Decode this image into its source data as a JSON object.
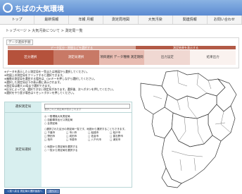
{
  "app": {
    "title": "ちばの大気環境"
  },
  "nav": [
    "トップ",
    "最新情報",
    "年報 月報",
    "測定局地図",
    "大気汚染",
    "関連情報",
    "お問い合わせ"
  ],
  "breadcrumb": "トップページ > 大気汚染について > 測定局一覧",
  "panel": {
    "title": "データ選択手順"
  },
  "progress": {
    "left_text": "データ区分・期間などを選択する",
    "right_text": "測定結果を表示する"
  },
  "steps": [
    "区分選択",
    "測定局選択",
    "項目選択 データ種類 測定期間",
    "出力設定",
    "結果出力"
  ],
  "instructions": [
    "※データを表示したい測定局を一覧または地図から選択してください。",
    "※地図上の測定局をクリックすると選択できます。",
    "※複数の測定局を選択する場合は、Ctrlキーを押しながら選択してください。",
    "※選択した測定局は下の表示欄に表示されます。",
    "※測定局は最大10局まで選択できます。",
    "※区分によっては、選択できない測定局があります。選択後、次へボタンを押してください。",
    "※選択をやり直す場合はリセットボタンを押してください。"
  ],
  "form": {
    "label1": "選択測定局",
    "hint": "選択された測定局が表示されます",
    "label2": "測定局選択",
    "options_top": [
      "◎ 一般環境大気測定局",
      "○ 自動車排出ガス測定局",
      "○ 全測定局"
    ],
    "note": "○選択された区分の測定局一覧です。地図から選択することもできます。",
    "grid": [
      "□ 千葉市",
      "□ 市川市",
      "□ 船橋市",
      "□ 松戸市",
      "□ 野田市",
      "□ 成田市",
      "□ 佐倉市",
      "□ 習志野市",
      "□ 柏市",
      "□ 市原市",
      "□ 八千代市",
      "□ 浦安市"
    ],
    "options_bottom": [
      "○ 地図から測定局を選択する",
      "○ 一覧から測定局を選択する"
    ]
  },
  "buttons": [
    "＜前へ戻る 測定局の選択画面へ",
    "次へ＞"
  ],
  "colors": {
    "header": "#5c8bd2",
    "step_active": "#b5523c",
    "form_label_bg": "#d8efef"
  }
}
